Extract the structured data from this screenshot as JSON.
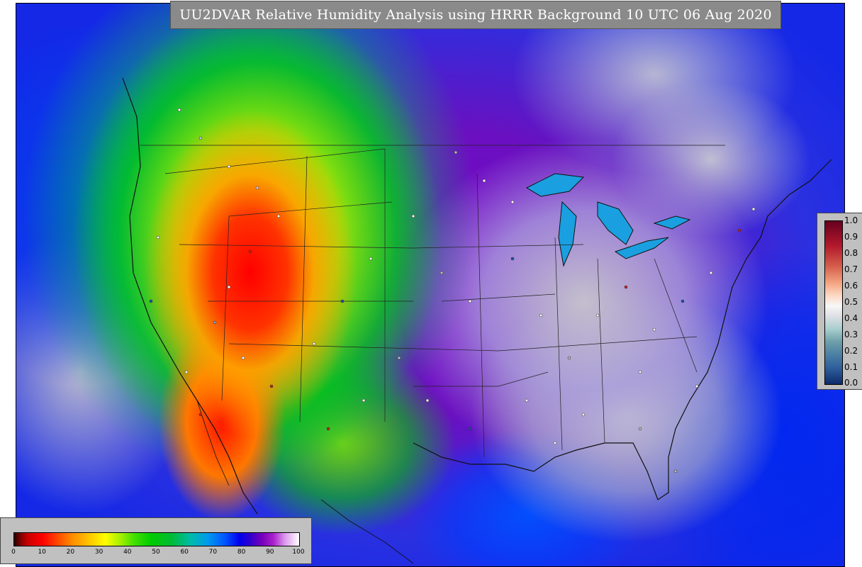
{
  "title": "UU2DVAR Relative Humidity Analysis using HRRR Background 10 UTC 06 Aug 2020",
  "rh_legend": {
    "tick_labels": [
      "0",
      "10",
      "20",
      "30",
      "40",
      "50",
      "60",
      "70",
      "80",
      "90",
      "100"
    ],
    "range": [
      0,
      100
    ]
  },
  "corr_legend": {
    "tick_labels": [
      "1.0",
      "0.9",
      "0.8",
      "0.7",
      "0.6",
      "0.5",
      "0.4",
      "0.3",
      "0.2",
      "0.1",
      "0.0"
    ],
    "range": [
      0.0,
      1.0
    ]
  },
  "colors": {
    "dry": "#ff0000",
    "moderate": "#00cc00",
    "moist": "#1428e6",
    "saturated": "#c8c8cc",
    "title_bg": "#8a8a8a"
  }
}
